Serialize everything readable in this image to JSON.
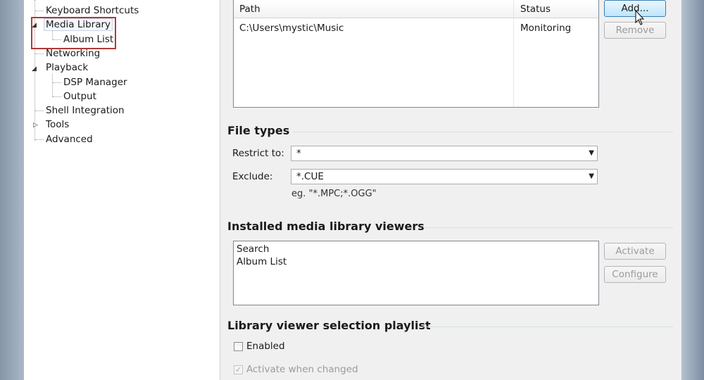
{
  "tree": {
    "items": [
      {
        "label": "Keyboard Shortcuts"
      },
      {
        "label": "Media Library"
      },
      {
        "label": "Album List"
      },
      {
        "label": "Networking"
      },
      {
        "label": "Playback"
      },
      {
        "label": "DSP Manager"
      },
      {
        "label": "Output"
      },
      {
        "label": "Shell Integration"
      },
      {
        "label": "Tools"
      },
      {
        "label": "Advanced"
      }
    ],
    "expanded_glyph": "◢",
    "collapsed_glyph": "▷"
  },
  "folders": {
    "columns": [
      "Path",
      "Status"
    ],
    "rows": [
      {
        "path": "C:\\Users\\mystic\\Music",
        "status": "Monitoring"
      }
    ],
    "add_label": "Add...",
    "remove_label": "Remove"
  },
  "file_types": {
    "title": "File types",
    "restrict_label": "Restrict to:",
    "restrict_value": "*",
    "exclude_label": "Exclude:",
    "exclude_value": "*.CUE",
    "hint": "eg. \"*.MPC;*.OGG\""
  },
  "viewers": {
    "title": "Installed media library viewers",
    "items": [
      "Search",
      "Album List"
    ],
    "activate_label": "Activate",
    "configure_label": "Configure"
  },
  "playlist": {
    "title": "Library viewer selection playlist",
    "enabled_label": "Enabled",
    "activate_changed_label": "Activate when changed"
  },
  "colors": {
    "highlight_box": "#b03a3a",
    "dialog_bg": "#f0f0f0"
  }
}
